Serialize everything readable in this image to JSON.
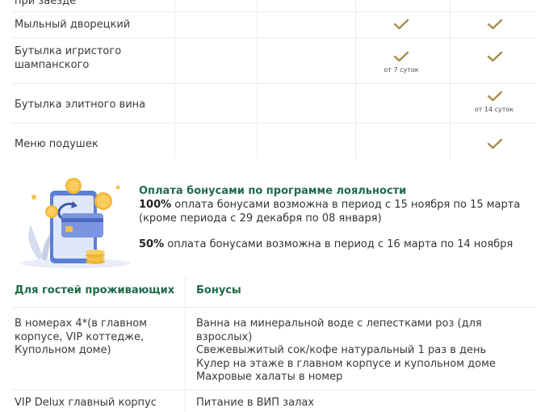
{
  "top_table": {
    "rows": [
      {
        "label": "при заезде",
        "check_col3": false,
        "check_col4": false
      },
      {
        "label": "Мыльный дворецкий",
        "check_col3": true,
        "check_col4": true
      },
      {
        "label_lines": [
          "Бутылка игристого",
          "шампанского"
        ],
        "check_col3": true,
        "check_col4": true,
        "note_col3": "от 7 суток"
      },
      {
        "label": "Бутылка элитного вина",
        "check_col3": false,
        "check_col4": true,
        "note_col4": "от 14 суток"
      },
      {
        "label": "Меню подушек",
        "check_col3": false,
        "check_col4": true
      }
    ],
    "check_color": "#a88a4a"
  },
  "promo": {
    "title": "Оплата бонусами по программе лояльности",
    "line1_bold": "100%",
    "line1_rest": " оплата бонусами возможна в период с 15 ноября по 15 марта",
    "line2": "(кроме периода с 29 декабря по 08 января)",
    "line3_bold": "50%",
    "line3_rest": " оплата бонусами возможна в период с 16 марта по 14 ноября"
  },
  "bonus_table": {
    "headers": [
      "Для гостей проживающих",
      "Бонусы"
    ],
    "rows": [
      {
        "guest_lines": [
          "В номерах 4*(в главном",
          "корпусе, VIP коттедже,",
          "Купольном доме)"
        ],
        "bonus_lines": [
          "Ванна на минеральной воде с лепестками роз (для",
          "взрослых)",
          "Свежевыжитый сок/кофе натуральный 1 раз в день",
          "Кулер на этаже в главном корпусе и купольном доме",
          "Махровые халаты в номер"
        ]
      },
      {
        "guest_lines": [
          "VIP Delux главный корпус"
        ],
        "bonus_lines": [
          "Питание в ВИП залах"
        ]
      }
    ],
    "accent": "#1f6a4a"
  }
}
